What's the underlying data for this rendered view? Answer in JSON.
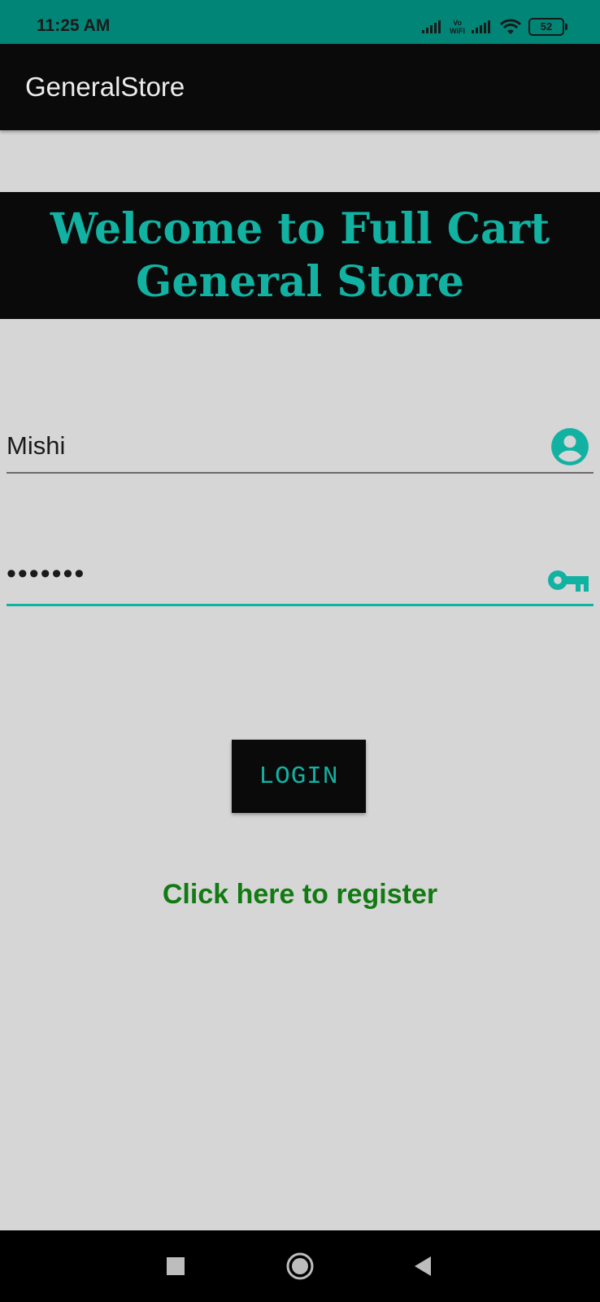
{
  "status_bar": {
    "time": "11:25 AM",
    "vowifi_top": "Vo",
    "vowifi_bottom": "WiFi",
    "battery": "52"
  },
  "app_bar": {
    "title": "GeneralStore"
  },
  "banner": {
    "line1": "Welcome to Full Cart",
    "line2": "General Store"
  },
  "form": {
    "username_value": "Mishi",
    "username_icon": "account-circle-icon",
    "password_value": "•••••••",
    "password_icon": "key-icon"
  },
  "login_button": {
    "label": "LOGIN"
  },
  "register_link": {
    "label": "Click here to register"
  },
  "colors": {
    "status_bar": "#018577",
    "accent": "#12b2a3",
    "dark": "#0a0a0a",
    "background": "#d6d6d6",
    "link": "#127a12"
  },
  "nav_bar": {
    "icons": [
      "recents-icon",
      "home-icon",
      "back-icon"
    ]
  }
}
